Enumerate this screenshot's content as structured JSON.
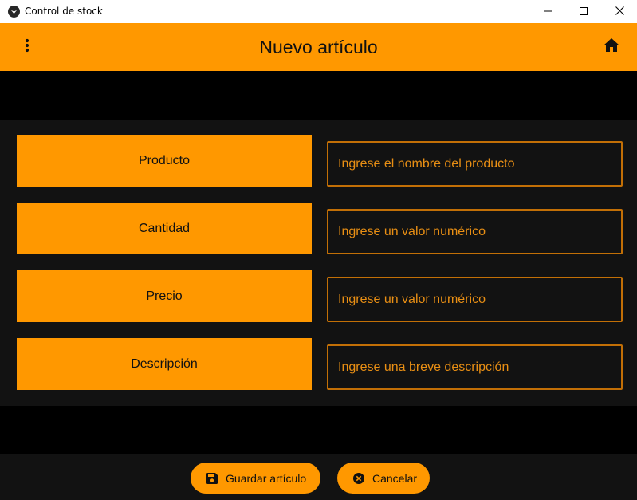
{
  "window": {
    "title": "Control de stock",
    "icons": {
      "app": "app-logo-icon",
      "minimize": "minimize-icon",
      "maximize": "maximize-icon",
      "close": "close-icon"
    }
  },
  "appbar": {
    "title": "Nuevo artículo",
    "menu_icon": "more-vert-icon",
    "home_icon": "home-icon",
    "color": "#ff9800"
  },
  "form": {
    "fields": [
      {
        "label": "Producto",
        "placeholder": "Ingrese el nombre del producto",
        "value": ""
      },
      {
        "label": "Cantidad",
        "placeholder": "Ingrese un valor numérico",
        "value": ""
      },
      {
        "label": "Precio",
        "placeholder": "Ingrese un valor numérico",
        "value": ""
      },
      {
        "label": "Descripción",
        "placeholder": "Ingrese una breve descripción",
        "value": ""
      }
    ]
  },
  "actions": {
    "save_label": "Guardar artículo",
    "save_icon": "floppy-disk-icon",
    "cancel_label": "Cancelar",
    "cancel_icon": "close-circle-icon"
  },
  "colors": {
    "accent": "#ff9800",
    "surface": "#121212",
    "background": "#000000",
    "field_border": "#c26f06"
  }
}
